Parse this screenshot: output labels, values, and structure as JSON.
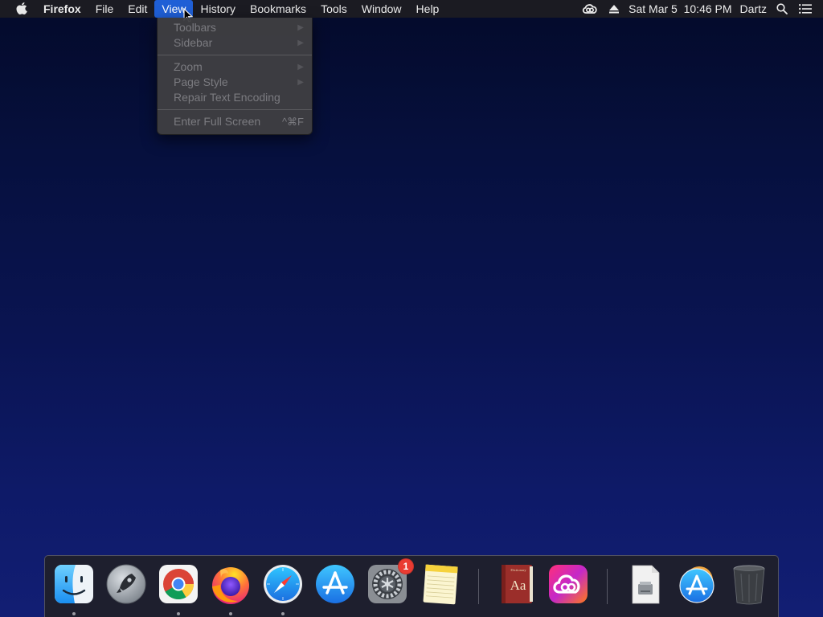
{
  "menubar": {
    "apple_icon": "apple-logo-icon",
    "app_name": "Firefox",
    "menus": [
      "File",
      "Edit",
      "View",
      "History",
      "Bookmarks",
      "Tools",
      "Window",
      "Help"
    ],
    "active_menu": "View",
    "status": {
      "cc_icon": "creative-cloud-icon",
      "eject_icon": "eject-icon",
      "datetime": "Sat Mar 5  10:46 PM",
      "user": "Dartz",
      "search_icon": "spotlight-search-icon",
      "notifications_icon": "notification-center-icon"
    }
  },
  "view_menu": {
    "toolbars": "Toolbars",
    "sidebar": "Sidebar",
    "zoom": "Zoom",
    "page_style": "Page Style",
    "repair_text_encoding": "Repair Text Encoding",
    "enter_full_screen": "Enter Full Screen",
    "enter_full_screen_shortcut": "^⌘F",
    "submenu_arrow": "▶"
  },
  "dock": {
    "apps": [
      {
        "name": "Finder",
        "icon": "finder-icon",
        "running": true
      },
      {
        "name": "Launchpad",
        "icon": "launchpad-icon",
        "running": false
      },
      {
        "name": "Google Chrome",
        "icon": "chrome-icon",
        "running": true
      },
      {
        "name": "Firefox",
        "icon": "firefox-icon",
        "running": true
      },
      {
        "name": "Safari",
        "icon": "safari-icon",
        "running": true
      },
      {
        "name": "App Store",
        "icon": "app-store-icon",
        "running": false
      },
      {
        "name": "System Preferences",
        "icon": "system-preferences-icon",
        "running": false,
        "badge": "1"
      },
      {
        "name": "Notes",
        "icon": "notes-icon",
        "running": false
      },
      {
        "name": "Dictionary",
        "icon": "dictionary-icon",
        "running": false
      },
      {
        "name": "Creative Cloud",
        "icon": "creative-cloud-app-icon",
        "running": false
      },
      {
        "name": "Downloads",
        "icon": "downloads-stack-icon",
        "running": false
      },
      {
        "name": "Applications",
        "icon": "applications-stack-icon",
        "running": false
      },
      {
        "name": "Trash",
        "icon": "trash-icon",
        "running": false
      }
    ],
    "dictionary_label": "Aa",
    "dictionary_title": "Dictionary",
    "sysprefs_badge": "1"
  },
  "colors": {
    "menu_highlight": "#1f5fd6",
    "badge": "#ea3b32",
    "desktop_top": "#040a2a",
    "desktop_bottom": "#121e74"
  }
}
